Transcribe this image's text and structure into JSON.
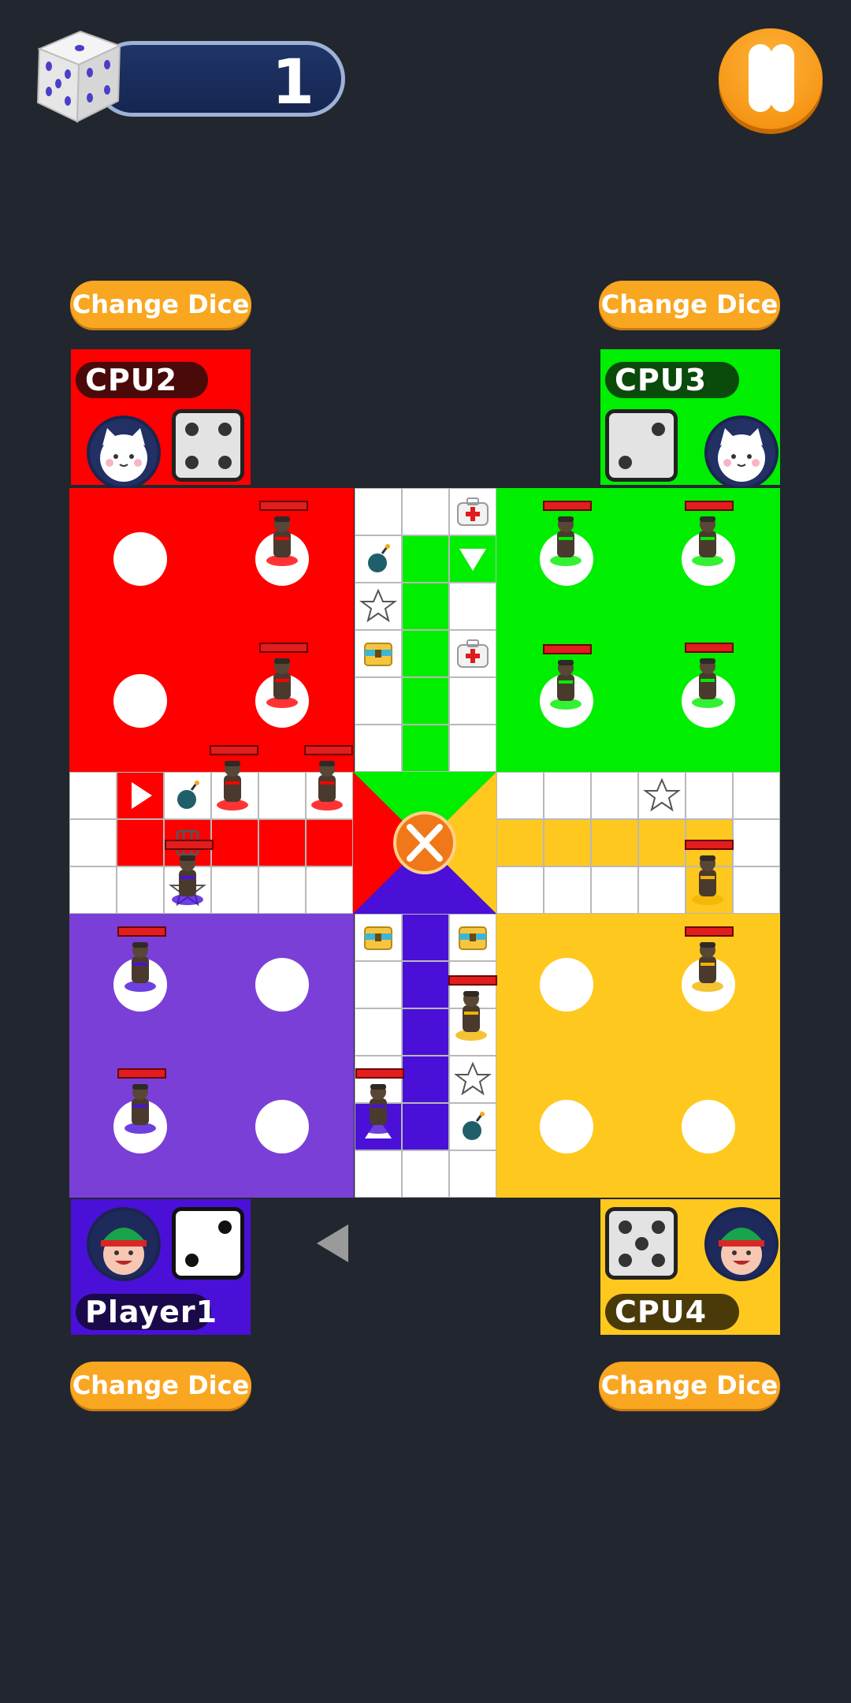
{
  "top_bar": {
    "dice_count": "1",
    "dice_icon": "dice-five-icon",
    "pause_icon": "pause-icon"
  },
  "change_dice_label": "Change Dice",
  "players": {
    "cpu2": {
      "name": "CPU2",
      "color": "#ff0000",
      "avatar": "cat-avatar",
      "die_value": 4
    },
    "cpu3": {
      "name": "CPU3",
      "color": "#00ee00",
      "avatar": "cat-avatar",
      "die_value": 2
    },
    "player1": {
      "name": "Player1",
      "color": "#4a10d8",
      "avatar": "elf-avatar",
      "die_value": 2
    },
    "cpu4": {
      "name": "CPU4",
      "color": "#ffc81e",
      "avatar": "elf-avatar",
      "die_value": 5
    }
  },
  "board": {
    "colors": {
      "red": "#ff0000",
      "green": "#00ee00",
      "purple": "#7a3fd6",
      "yellow": "#ffc81e",
      "blue_path": "#4a10d8"
    },
    "center_icon": "crossed-swords-icon",
    "cell_icons": [
      "medkit-icon",
      "bomb-icon",
      "star-icon",
      "treasure-chest-icon",
      "arrow-icon",
      "cage-icon"
    ]
  },
  "turn_indicator_icon": "left-arrow-icon"
}
